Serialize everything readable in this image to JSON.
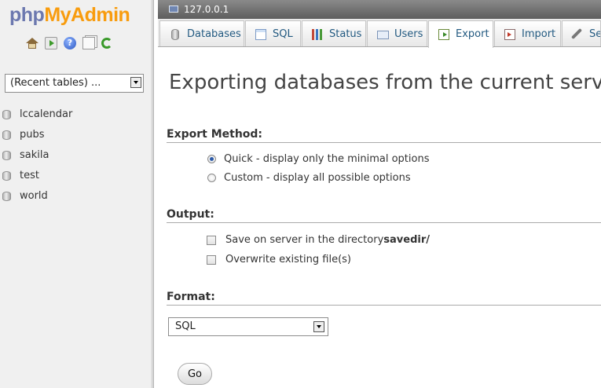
{
  "logo": {
    "part1": "php",
    "part2": "MyAdmin"
  },
  "nav_icons": [
    "home-icon",
    "exit-icon",
    "help-icon",
    "docs-icon",
    "reload-icon"
  ],
  "recent_tables": {
    "selected": "(Recent tables) ..."
  },
  "databases": [
    "lccalendar",
    "pubs",
    "sakila",
    "test",
    "world"
  ],
  "server": {
    "name": "127.0.0.1"
  },
  "tabs": [
    {
      "label": "Databases",
      "icon": "database-icon"
    },
    {
      "label": "SQL",
      "icon": "sql-icon"
    },
    {
      "label": "Status",
      "icon": "status-icon"
    },
    {
      "label": "Users",
      "icon": "users-icon"
    },
    {
      "label": "Export",
      "icon": "export-icon",
      "active": true
    },
    {
      "label": "Import",
      "icon": "import-icon"
    },
    {
      "label": "Se",
      "icon": "settings-icon"
    }
  ],
  "main": {
    "title": "Exporting databases from the current server",
    "export_method": {
      "heading": "Export Method:",
      "quick": "Quick - display only the minimal options",
      "custom": "Custom - display all possible options",
      "selected": "quick"
    },
    "output": {
      "heading": "Output:",
      "save_prefix": "Save on server in the directory ",
      "save_dir": "savedir/",
      "overwrite": "Overwrite existing file(s)"
    },
    "format": {
      "heading": "Format:",
      "selected": "SQL"
    },
    "go_label": "Go"
  },
  "colors": {
    "logo_php": "#6c78af",
    "logo_myadmin": "#f89c0e",
    "tab_text": "#235a81"
  }
}
